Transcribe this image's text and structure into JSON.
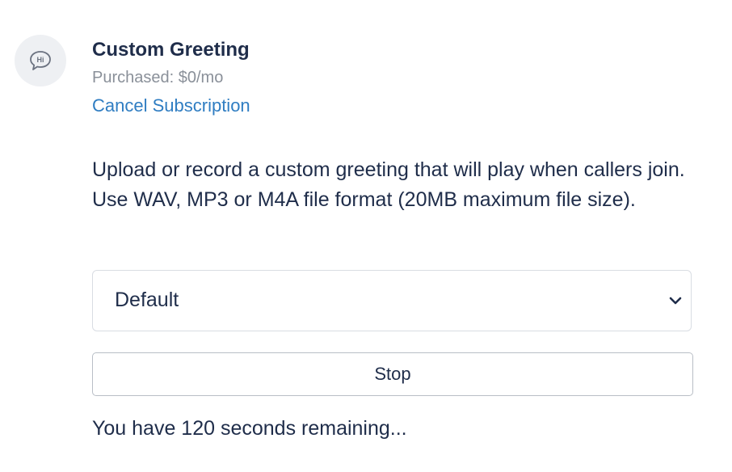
{
  "feature": {
    "icon": "speech-bubble-hi-icon",
    "icon_text": "Hi",
    "title": "Custom Greeting",
    "purchased": "Purchased: $0/mo",
    "cancel_label": "Cancel Subscription"
  },
  "description": "Upload or record a custom greeting that will play when callers join. Use WAV, MP3 or M4A file format (20MB maximum file size).",
  "greeting_select": {
    "selected": "Default",
    "icon": "chevron-down-icon"
  },
  "stop_label": "Stop",
  "status_text": "You have 120 seconds remaining...",
  "colors": {
    "text": "#1f2d4a",
    "muted": "#8a9099",
    "link": "#2f7dc2",
    "avatar_bg": "#eef0f3"
  }
}
